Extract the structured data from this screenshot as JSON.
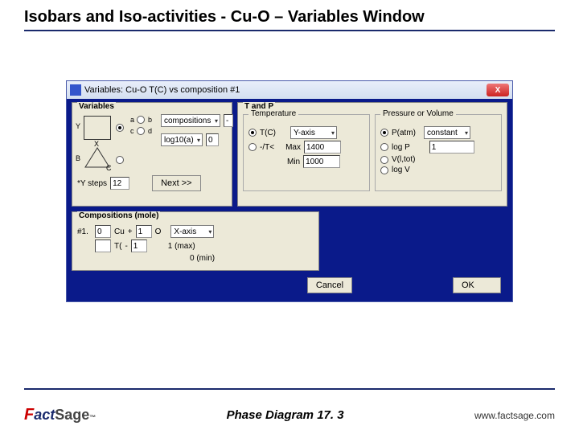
{
  "slide": {
    "title": "Isobars and Iso-activities - Cu-O – Variables Window",
    "footer_center": "Phase Diagram  17. 3",
    "footer_url": "www.factsage.com",
    "logo_f": "F",
    "logo_act": "act",
    "logo_sage": "Sage",
    "logo_tm": "™"
  },
  "window": {
    "title": "Variables: Cu-O  T(C) vs composition #1",
    "close": "X"
  },
  "variables": {
    "legend": "Variables",
    "y_label": "Y",
    "x_label": "X",
    "a": "a",
    "b": "b",
    "c": "c",
    "d": "d",
    "B": "B",
    "C": "C",
    "compositions": "compositions",
    "compositions_val": "-",
    "log10a": "log10(a)",
    "log10a_val": "0",
    "y_steps_label": "*Y steps",
    "y_steps_val": "12",
    "next": "Next >>"
  },
  "tp": {
    "legend": "T and P",
    "temp_legend": "Temperature",
    "pv_legend": "Pressure or Volume",
    "TC": "T(C)",
    "TK": "-/T<",
    "yaxis": "Y-axis",
    "max_label": "Max",
    "max_val": "1400",
    "min_label": "Min",
    "min_val": "1000",
    "Patm": "P(atm)",
    "constant": "constant",
    "logP": "log P",
    "p_val": "1",
    "Vl": "V(l,tot)",
    "logV": "log V"
  },
  "comp": {
    "legend": "Compositions (mole)",
    "row": "#1.",
    "cu_val": "0",
    "cu_lbl": "Cu",
    "plus": "+",
    "one": "1",
    "o_lbl": "O",
    "xaxis": "X-axis",
    "t_dash": "T(",
    "dash": "-",
    "one2": "1",
    "max_label": "1  (max)",
    "min_label": "0  (min)"
  },
  "buttons": {
    "cancel": "Cancel",
    "ok": "OK"
  }
}
